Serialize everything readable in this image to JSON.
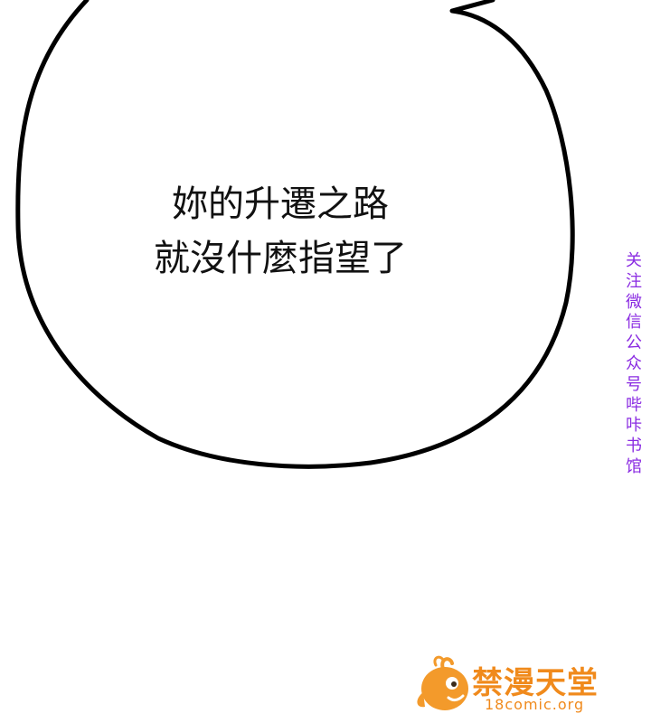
{
  "dialogue": {
    "lines": [
      "妳的升遷之路",
      "就沒什麼指望了"
    ]
  },
  "side_note": {
    "text": "关注微信公众号哔咔书馆",
    "color": "#8a2be2"
  },
  "watermark": {
    "name": "禁漫天堂",
    "url": "18comic.org",
    "icon": "orange-fish-mascot-icon",
    "color": "#f08a1c"
  }
}
